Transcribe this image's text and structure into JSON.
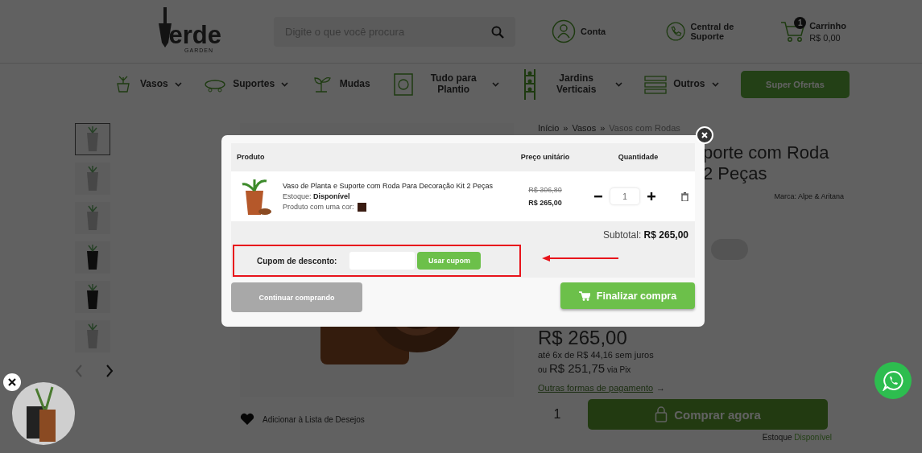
{
  "header": {
    "logo": {
      "text": "erde",
      "tagline": "GARDEN"
    },
    "search": {
      "placeholder": "Digite o que você procura"
    },
    "account": "Conta",
    "support": "Central de Suporte",
    "cart": {
      "count": "1",
      "label": "Carrinho",
      "total": "R$ 0,00"
    }
  },
  "nav": {
    "items": [
      {
        "label": "Vasos",
        "dropdown": true
      },
      {
        "label": "Suportes",
        "dropdown": true
      },
      {
        "label": "Mudas",
        "dropdown": false
      },
      {
        "label": "Tudo para Plantio",
        "dropdown": true
      },
      {
        "label": "Jardins Verticais",
        "dropdown": true
      },
      {
        "label": "Outros",
        "dropdown": true
      }
    ],
    "promo_button": "Super Ofertas"
  },
  "gallery": {
    "thumbnails": [
      {
        "selected": true
      },
      {
        "selected": false
      },
      {
        "selected": false
      },
      {
        "selected": false
      },
      {
        "selected": false
      },
      {
        "selected": false
      }
    ],
    "prev_enabled": false,
    "wishlist": "Adicionar à Lista de Desejos"
  },
  "product": {
    "breadcrumb": [
      {
        "label": "Início",
        "current": false
      },
      {
        "label": "Vasos",
        "current": false
      },
      {
        "label": "Vasos com Rodas",
        "current": true
      }
    ],
    "separator": "»",
    "title_lines": [
      "porte com Roda",
      "2 Peças"
    ],
    "brand": "Marca: Alpe & Aritana",
    "price": "R$ 265,00",
    "installments": "até 6x de R$ 44,16 sem juros",
    "pix": {
      "prefix": "ou",
      "amount": "R$ 251,75",
      "suffix": "via Pix"
    },
    "payment_link": "Outras formas de pagamento",
    "payment_link_arrow": "→",
    "quantity": "1",
    "buy_button": "Comprar agora",
    "stock_label": "Estoque",
    "stock": "Disponível"
  },
  "cart_modal": {
    "columns": [
      "Produto",
      "Preço unitário",
      "Quantidade"
    ],
    "items": [
      {
        "name": "Vaso de Planta e Suporte com Roda Para Decoração Kit 2 Peças",
        "stock_label": "Estoque:",
        "stock": "Disponível",
        "color_label": "Produto com uma cor:",
        "color": "#3a1c12",
        "old_price": "R$ 306,80",
        "price": "R$ 265,00",
        "quantity": "1"
      }
    ],
    "subtotal_label": "Subtotal:",
    "subtotal": "R$ 265,00",
    "coupon": {
      "label": "Cupom de desconto:",
      "button": "Usar cupom",
      "highlighted": true
    },
    "continue_button": "Continuar comprando",
    "checkout_button": "Finalizar compra"
  }
}
